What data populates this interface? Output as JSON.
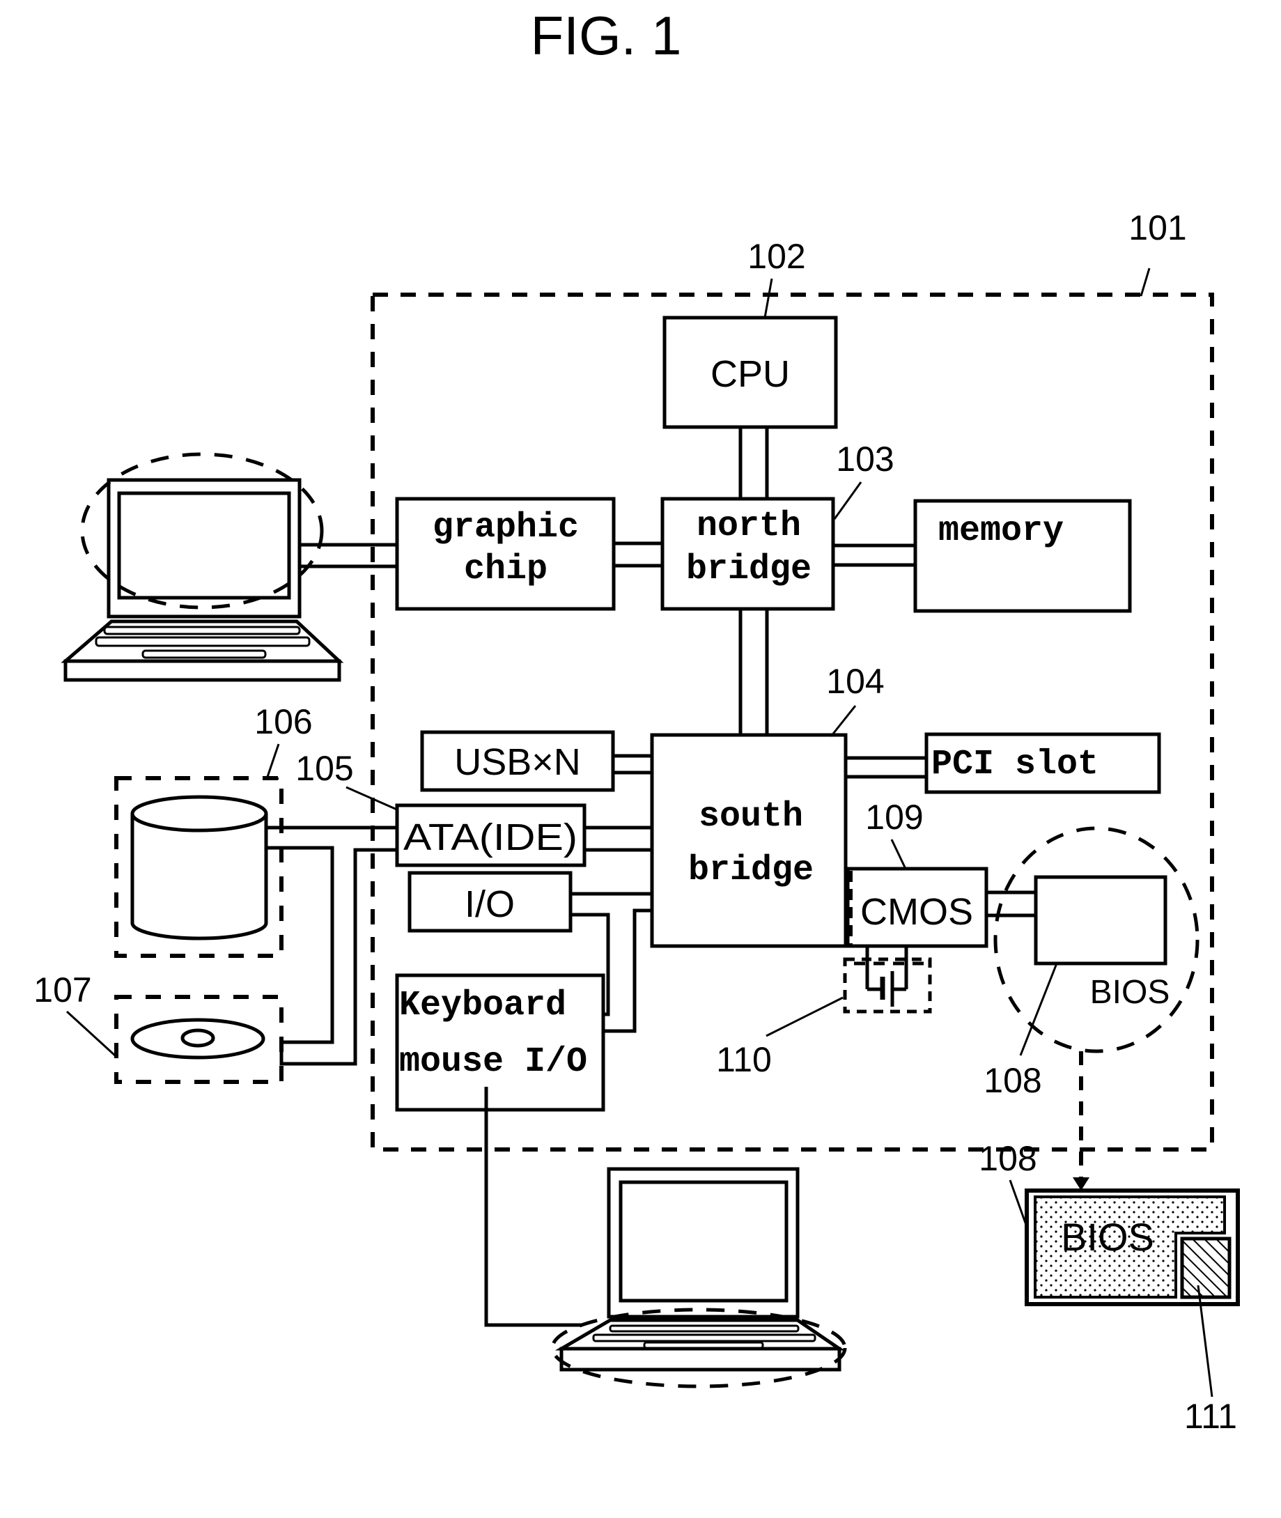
{
  "figure": {
    "title": "FIG. 1"
  },
  "components": {
    "cpu": "CPU",
    "north_bridge": [
      "north",
      "bridge"
    ],
    "graphic_chip": [
      "graphic",
      "chip"
    ],
    "memory": "memory",
    "south_bridge": [
      "south",
      "bridge"
    ],
    "usb": "USB×N",
    "pci_slot": "PCI slot",
    "ata_ide": "ATA(IDE)",
    "io": "I/O",
    "cmos": "CMOS",
    "bios_chip": "BIOS",
    "keyboard_mouse_io": [
      "Keyboard",
      "mouse I/O"
    ],
    "bios_detail": "BIOS"
  },
  "reference_numerals": {
    "system_board": "101",
    "cpu": "102",
    "north_bridge": "103",
    "south_bridge": "104",
    "ata_ide": "105",
    "hard_disk": "106",
    "optical_drive": "107",
    "bios_chip": "108",
    "cmos": "109",
    "jumper": "110",
    "bios_detail": "108",
    "bios_region": "111"
  },
  "colors": {
    "ink": "#000000",
    "background": "#ffffff"
  }
}
